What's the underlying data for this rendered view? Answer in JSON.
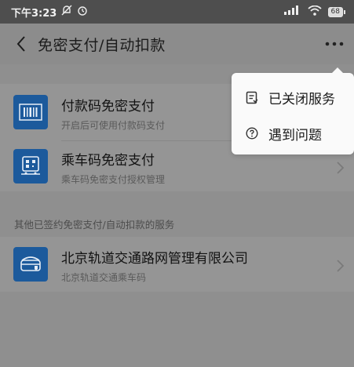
{
  "status_bar": {
    "time": "下午3:23",
    "battery": "68"
  },
  "header": {
    "title": "免密支付/自动扣款"
  },
  "services": [
    {
      "title": "付款码免密支付",
      "subtitle": "开启后可使用付款码支付",
      "icon": "barcode-icon"
    },
    {
      "title": "乘车码免密支付",
      "subtitle": "乘车码免密支付授权管理",
      "icon": "bus-qr-icon"
    }
  ],
  "other_section": {
    "label": "其他已签约免密支付/自动扣款的服务",
    "items": [
      {
        "title": "北京轨道交通路网管理有限公司",
        "subtitle": "北京轨道交通乘车码",
        "icon": "metro-icon"
      }
    ]
  },
  "popup_menu": {
    "items": [
      {
        "label": "已关闭服务",
        "icon": "closed-service-icon"
      },
      {
        "label": "遇到问题",
        "icon": "help-icon"
      }
    ]
  },
  "colors": {
    "overlay_bg": "#8f8f8f",
    "icon_blue": "#1c5a9c",
    "popup_bg": "#fafafa"
  }
}
